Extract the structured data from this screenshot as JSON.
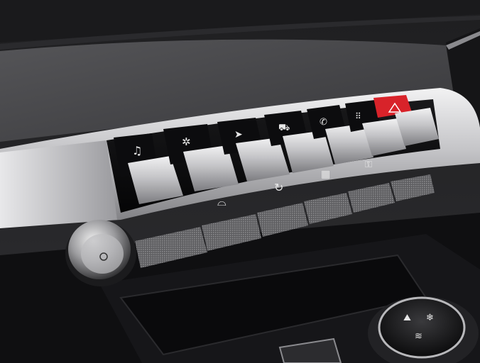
{
  "photo": {
    "subject": "car-center-console-toggle-switches",
    "colors": {
      "dashboard": "#2c2c2e",
      "fabric": "#4a4a4d",
      "chrome": "#c9c9cc",
      "piano_black": "#0d0d0f",
      "hazard_red": "#d8232a",
      "icon": "#e6e6e6"
    },
    "toggles": [
      {
        "name": "media",
        "icon": "music-note-icon"
      },
      {
        "name": "climate",
        "icon": "fan-icon"
      },
      {
        "name": "navigation",
        "icon": "navigation-arrow-icon"
      },
      {
        "name": "vehicle",
        "icon": "car-icon"
      },
      {
        "name": "phone",
        "icon": "phone-icon"
      },
      {
        "name": "apps",
        "icon": "apps-grid-icon"
      },
      {
        "name": "hazard",
        "icon": "hazard-triangle-icon"
      }
    ],
    "lower_icons": [
      {
        "name": "front-defrost",
        "icon": "windshield-defrost-icon"
      },
      {
        "name": "recirculation",
        "icon": "recirculation-icon"
      },
      {
        "name": "rear-defrost",
        "icon": "rear-defrost-icon"
      },
      {
        "name": "lock",
        "icon": "lock-icon"
      }
    ]
  }
}
